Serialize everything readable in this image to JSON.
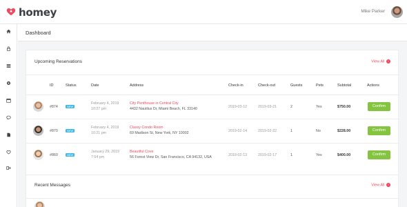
{
  "app": {
    "name": "homey"
  },
  "user": {
    "name": "Mike Parker"
  },
  "sidebar": {
    "items": [
      {
        "icon": "home-icon"
      },
      {
        "icon": "lock-icon"
      },
      {
        "icon": "list-icon"
      },
      {
        "icon": "settings-icon"
      },
      {
        "icon": "calendar-icon"
      },
      {
        "icon": "chat-icon"
      },
      {
        "icon": "document-icon"
      },
      {
        "icon": "heart-icon"
      },
      {
        "icon": "logout-icon"
      }
    ]
  },
  "page": {
    "title": "Dashboard"
  },
  "reservations": {
    "title": "Upcoming Reservations",
    "view_all": "View All",
    "columns": [
      "ID",
      "Status",
      "Date",
      "Address",
      "Check-in",
      "Check-out",
      "Guests",
      "Pets",
      "Subtotal",
      "Actions"
    ],
    "rows": [
      {
        "id": "#874",
        "status": "NEW",
        "date": "February 4, 2019",
        "time": "10:27 pm",
        "title": "City Penthouse in Central City",
        "address": "4432 Nautilus Dr, Miami Beach, FL 33140",
        "checkin": "2019-03-12",
        "checkout": "2019-03-21",
        "guests": "2",
        "pets": "Yes",
        "subtotal": "$750.00",
        "action": "Confirm"
      },
      {
        "id": "#870",
        "status": "NEW",
        "date": "February 4, 2019",
        "time": "10:21 pm",
        "title": "Classy Condo Room",
        "address": "69 Madison St, New York, NY 10002",
        "checkin": "2019-02-14",
        "checkout": "2019-02-22",
        "guests": "1",
        "pets": "No",
        "subtotal": "$228.00",
        "action": "Confirm"
      },
      {
        "id": "#860",
        "status": "NEW",
        "date": "January 29, 2019",
        "time": "7:54 pm",
        "title": "Beautiful Cove",
        "address": "56 Forest View Dr, San Francisco, CA 94132, USA",
        "checkin": "2019-02-13",
        "checkout": "2019-02-17",
        "guests": "1",
        "pets": "Yes",
        "subtotal": "$400.00",
        "action": "Confirm"
      }
    ]
  },
  "messages": {
    "title": "Recent Messages",
    "view_all": "View All"
  },
  "colors": {
    "accent": "#f1485d",
    "confirm": "#85c440",
    "badge": "#3cb9e8"
  }
}
